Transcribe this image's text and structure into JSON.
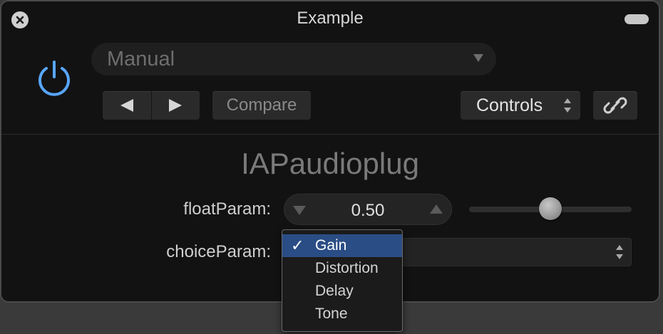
{
  "window": {
    "title": "Example"
  },
  "header": {
    "preset": {
      "value": "Manual"
    },
    "compare_label": "Compare",
    "controls_label": "Controls"
  },
  "plugin": {
    "name": "IAPaudioplug",
    "float_param": {
      "label": "floatParam:",
      "value": "0.50",
      "slider_fraction": 0.5
    },
    "choice_param": {
      "label": "choiceParam:",
      "options": [
        "Gain",
        "Distortion",
        "Delay",
        "Tone"
      ],
      "selected_index": 0
    }
  },
  "colors": {
    "power_accent": "#58a6ff",
    "selection": "#2a4d85"
  },
  "icons": {
    "close": "close-icon",
    "power": "power-icon",
    "prev": "prev-arrow-icon",
    "next": "next-arrow-icon",
    "link": "link-icon",
    "checkmark": "checkmark-icon"
  }
}
